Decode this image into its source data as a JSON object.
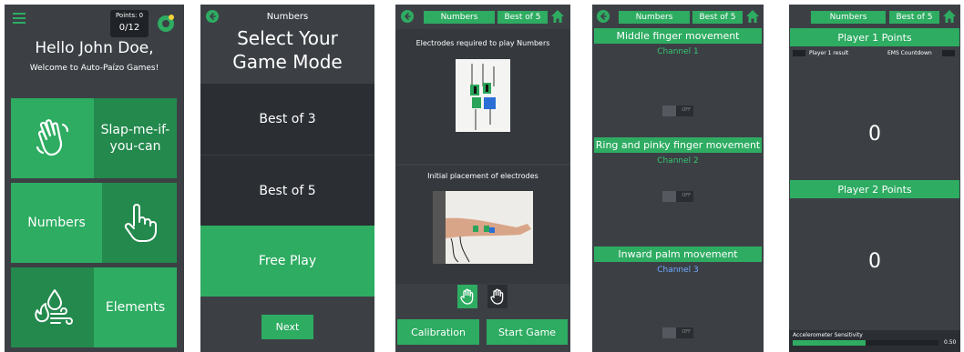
{
  "screen1": {
    "points_label": "Points: 0",
    "points_value": "0/12",
    "greeting": "Hello John Doe,",
    "welcome": "Welcome to Auto-Paízo Games!",
    "tiles": [
      {
        "label": "Slap-me-if-you-can",
        "icon": "waving-hand-icon"
      },
      {
        "label": "Numbers",
        "icon": "pointing-hand-icon"
      },
      {
        "label": "Elements",
        "icon": "elements-icon"
      }
    ]
  },
  "screen2": {
    "header": "Numbers",
    "title": "Select Your Game Mode",
    "options": [
      "Best of 3",
      "Best of 5",
      "Free Play"
    ],
    "selected": "Free Play",
    "next_label": "Next"
  },
  "screen3": {
    "game": "Numbers",
    "mode": "Best of 5",
    "electrodes_title": "Electrodes required to play Numbers",
    "placement_title": "Initial placement of electrodes",
    "calibration_label": "Calibration",
    "start_label": "Start Game"
  },
  "screen4": {
    "game": "Numbers",
    "mode": "Best of 5",
    "movements": [
      {
        "name": "Middle finger movement",
        "channel": "Channel 1",
        "toggle": "OFF"
      },
      {
        "name": "Ring and pinky finger movement",
        "channel": "Channel 2",
        "toggle": "OFF"
      },
      {
        "name": "Inward palm movement",
        "channel": "Channel 3",
        "toggle": "OFF"
      }
    ]
  },
  "screen5": {
    "game": "Numbers",
    "mode": "Best of 5",
    "p1_header": "Player 1 Points",
    "p1_result_label": "Player 1 result",
    "ems_label": "EMS Countdown",
    "p1_score": "0",
    "p2_header": "Player 2 Points",
    "p2_score": "0",
    "sensitivity_label": "Accelerometer Sensitivity",
    "sensitivity_value": "0.50",
    "sensitivity_fraction": 0.5
  },
  "colors": {
    "accent": "#2eac62",
    "accent_dark": "#23894d",
    "background": "#3c4045",
    "panel_dark": "#2b2e33",
    "channel_text": "#35c36f"
  }
}
